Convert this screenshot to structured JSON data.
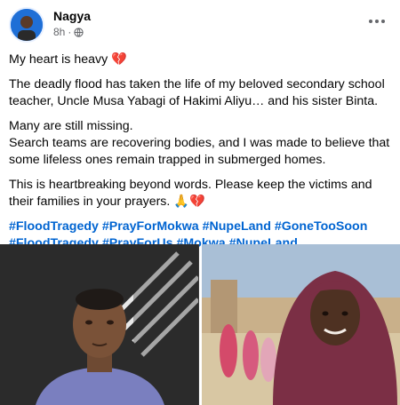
{
  "post": {
    "author": "Nagya",
    "time": "8h",
    "visibility_icon": "globe-icon",
    "paragraphs": [
      "My heart is heavy 💔",
      "The deadly flood has taken the life of my beloved secondary school teacher, Uncle Musa Yabagi of Hakimi Aliyu… and his sister Binta.",
      "Many are still missing.",
      "Search teams are recovering bodies, and I was made to believe that some lifeless ones remain trapped in submerged homes.",
      "This is heartbreaking beyond words. Please keep the victims and their families in your prayers. 🙏💔"
    ],
    "hashtags": [
      "#FloodTragedy",
      "#PrayForMokwa",
      "#NupeLand",
      "#GoneTooSoon",
      "#FloodTragedy",
      "#PrayForUs",
      "#Mokwa",
      "#NupeLand"
    ]
  },
  "colors": {
    "hashtag": "#0064d1",
    "meta": "#65676b",
    "text": "#050505"
  }
}
